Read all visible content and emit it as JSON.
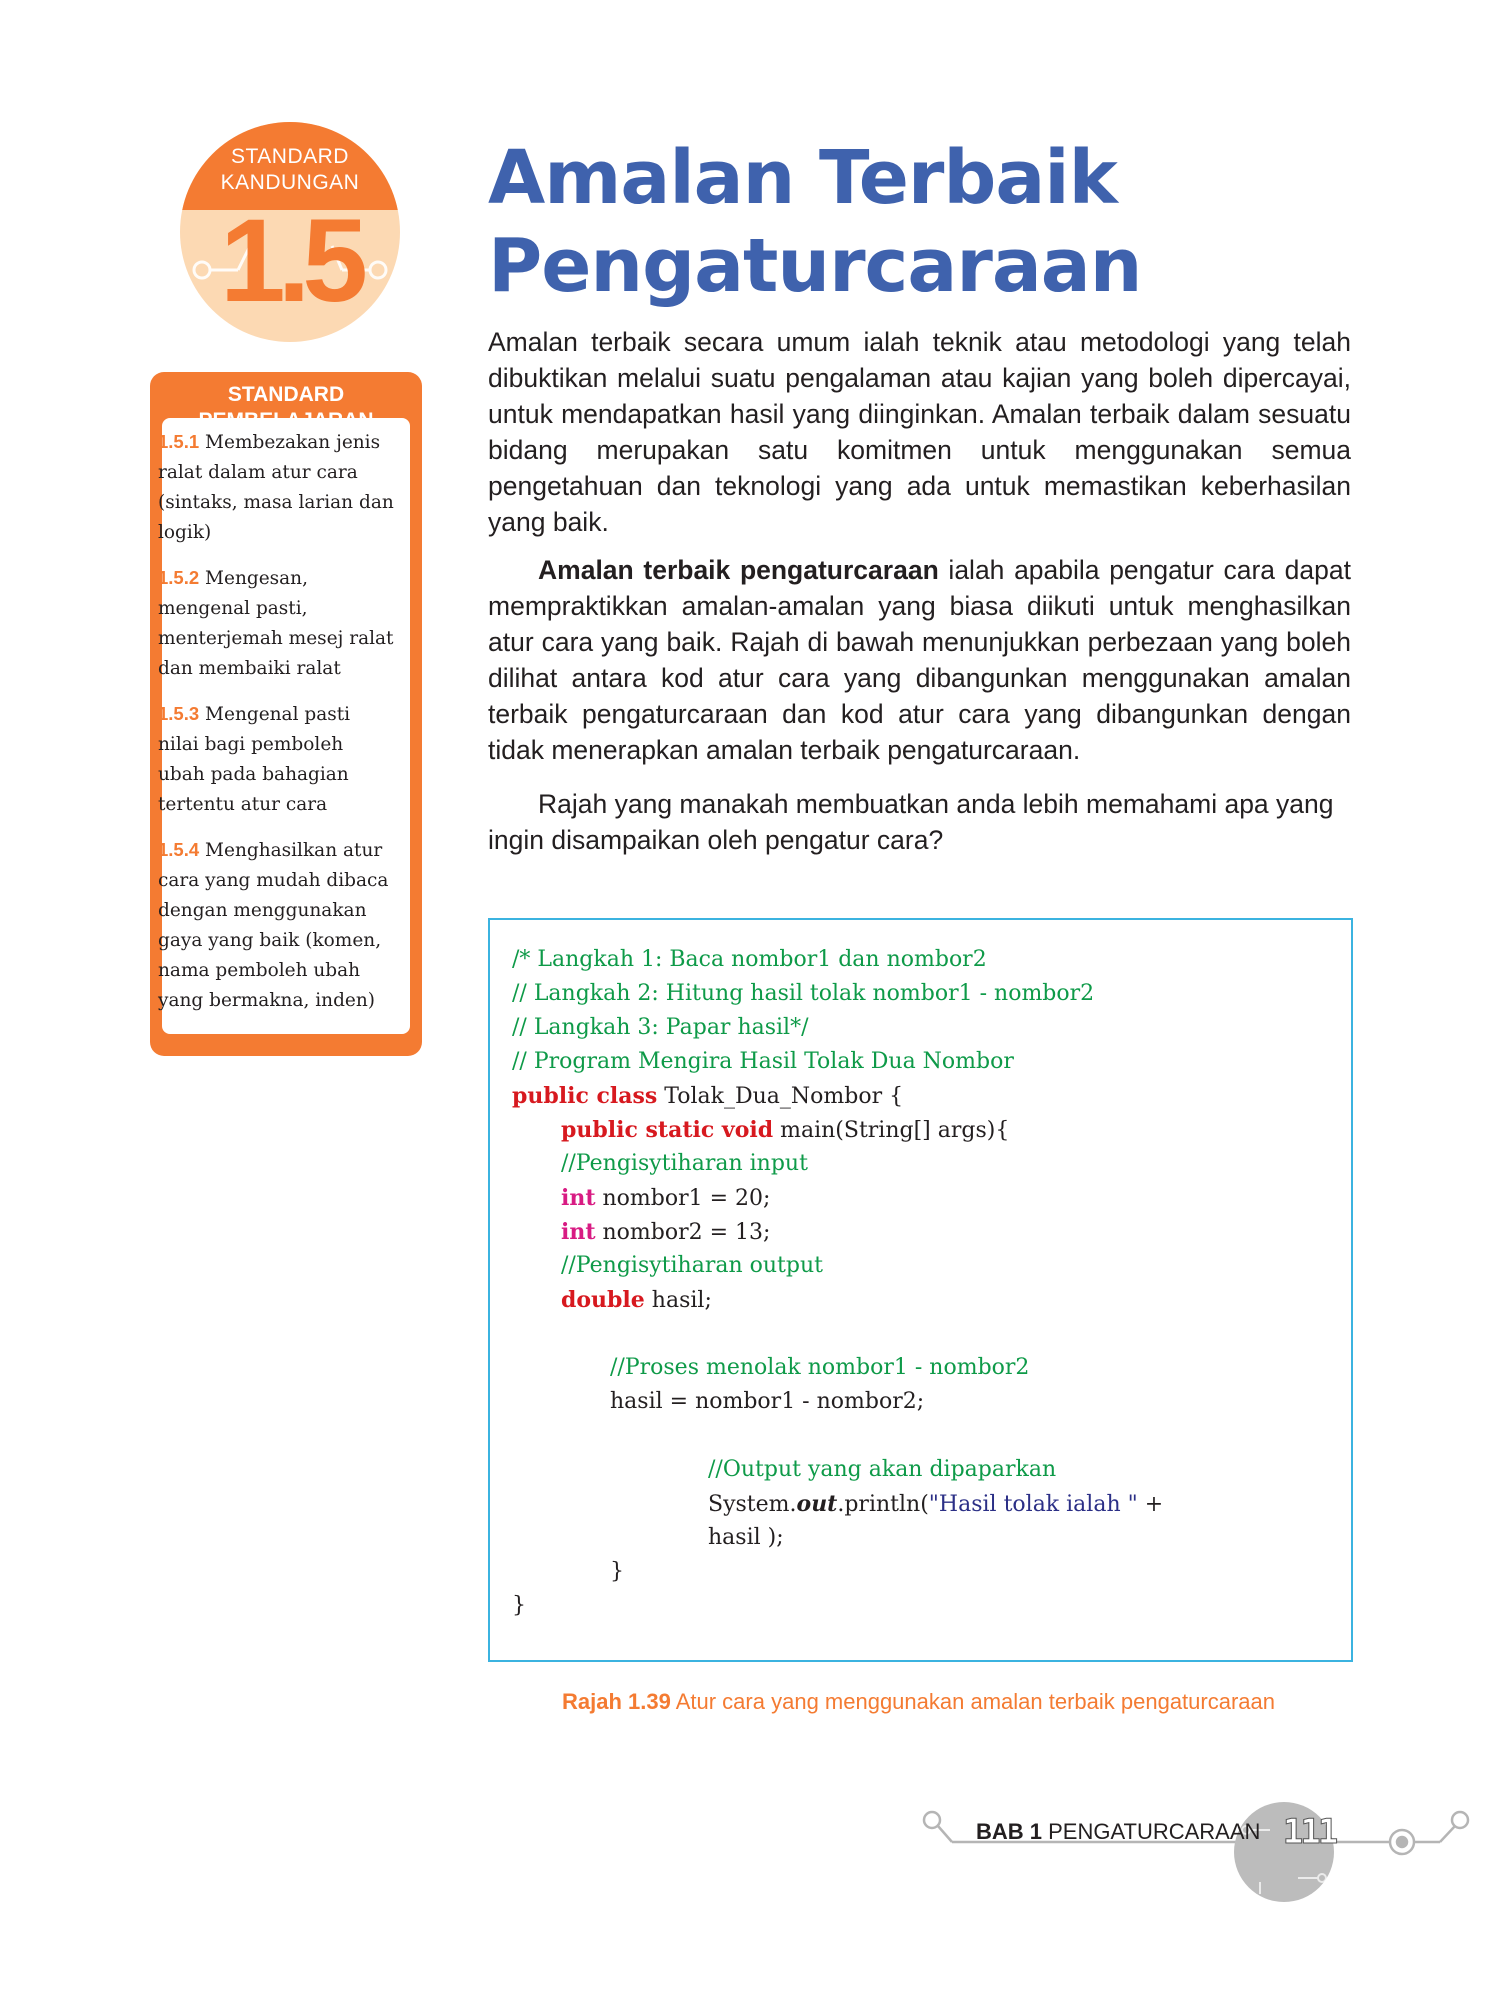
{
  "badge": {
    "label_line1": "STANDARD",
    "label_line2": "KANDUNGAN",
    "number": "1.5"
  },
  "standard_pembelajaran": {
    "title": "STANDARD PEMBELAJARAN",
    "items": [
      {
        "code": "1.5.1",
        "lines": [
          "Membezakan jenis",
          "ralat dalam atur cara",
          "(sintaks, masa larian dan",
          "logik)"
        ]
      },
      {
        "code": "1.5.2",
        "lines": [
          "Mengesan,",
          "mengenal pasti,",
          "menterjemah mesej ralat",
          "dan membaiki ralat"
        ]
      },
      {
        "code": "1.5.3",
        "lines": [
          "Mengenal pasti",
          "nilai bagi pemboleh",
          "ubah pada bahagian",
          "tertentu atur cara"
        ]
      },
      {
        "code": "1.5.4",
        "lines": [
          "Menghasilkan atur",
          "cara yang mudah dibaca",
          "dengan menggunakan",
          "gaya yang baik (komen,",
          "nama pemboleh ubah",
          "yang bermakna, inden)"
        ]
      }
    ]
  },
  "title": {
    "line1": "Amalan Terbaik",
    "line2": "Pengaturcaraan"
  },
  "paragraphs": {
    "p1": "Amalan terbaik secara umum ialah teknik atau metodologi yang telah dibuktikan melalui suatu pengalaman atau kajian yang boleh dipercayai, untuk mendapatkan hasil yang diinginkan. Amalan terbaik dalam sesuatu bidang merupakan satu komitmen untuk menggunakan semua pengetahuan dan teknologi yang ada untuk memastikan keberhasilan yang baik.",
    "p2_bold": "Amalan terbaik pengaturcaraan",
    "p2_rest": " ialah apabila pengatur cara dapat mempraktikkan amalan-amalan yang biasa diikuti untuk menghasilkan atur cara yang baik. Rajah di bawah menunjukkan perbezaan yang boleh dilihat antara kod atur cara yang dibangunkan menggunakan amalan terbaik pengaturcaraan dan kod atur cara yang dibangunkan dengan tidak menerapkan amalan terbaik pengaturcaraan.",
    "p3": "Rajah yang manakah membuatkan anda lebih memahami apa yang ingin disampaikan oleh pengatur cara?"
  },
  "code": {
    "l1": "/* Langkah 1: Baca nombor1 dan nombor2",
    "l2": "// Langkah 2: Hitung hasil tolak nombor1 - nombor2",
    "l3": "// Langkah 3: Papar hasil*/",
    "l4": "// Program Mengira Hasil Tolak Dua Nombor",
    "l5_kw": "public class",
    "l5_rest": " Tolak_Dua_Nombor {",
    "l6_kw": "public static void",
    "l6_rest": " main(String[] args){",
    "l7": "//Pengisytiharan input",
    "l8_kw": "int",
    "l8_rest": " nombor1 = 20;",
    "l9_kw": "int",
    "l9_rest": " nombor2 = 13;",
    "l10": "//Pengisytiharan output",
    "l11_kw": "double",
    "l11_rest": " hasil;",
    "l12": "//Proses menolak nombor1 - nombor2",
    "l13": "hasil = nombor1 - nombor2;",
    "l14": "//Output yang akan dipaparkan",
    "l15_a": "System.",
    "l15_out": "out",
    "l15_b": ".println(",
    "l15_str": "\"Hasil tolak ialah \"",
    "l15_c": " +",
    "l16": "hasil );",
    "l17": "}",
    "l18": "}"
  },
  "caption": {
    "label": "Rajah 1.39",
    "text": " Atur cara yang menggunakan amalan terbaik pengaturcaraan"
  },
  "footer": {
    "bab": "BAB 1",
    "chapter": " PENGATURCARAAN",
    "page": "111"
  },
  "colors": {
    "orange": "#f47b32",
    "title_blue": "#3f62ad",
    "code_green": "#0e9a48",
    "code_red": "#d7191f",
    "code_pink": "#d81b83",
    "code_string": "#2b2f86",
    "code_border": "#3bb3e0"
  }
}
